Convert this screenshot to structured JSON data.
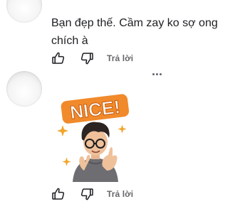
{
  "comments": [
    {
      "text": "Bạn đẹp thế. Cầm zay ko sợ ong chích à",
      "actions": {
        "reply_label": "Trả lời"
      }
    },
    {
      "sticker": {
        "text": "NICE!",
        "icon": "sticker-nice-boy-icon"
      },
      "actions": {
        "reply_label": "Trả lời"
      }
    }
  ],
  "icons": {
    "like": "thumbs-up-icon",
    "dislike": "thumbs-down-icon",
    "more": "more-options-icon"
  },
  "colors": {
    "text": "#1c1e21",
    "secondary": "#65676b",
    "sticker_banner": "#f08a2b",
    "sparkle": "#f3a52c"
  }
}
